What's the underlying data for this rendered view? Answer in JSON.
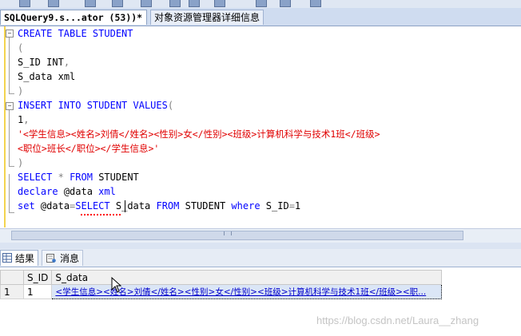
{
  "tabs": {
    "query_tab": "SQLQuery9.s...ator (53))*",
    "object_explorer_tab": "对象资源管理器详细信息"
  },
  "editor": {
    "lines": {
      "l1": {
        "kw1": "CREATE TABLE STUDENT"
      },
      "l2": {
        "p": "("
      },
      "l3": {
        "a": "S_ID",
        "b": "INT",
        "c": ","
      },
      "l4": {
        "a": "S_data",
        "b": "xml"
      },
      "l5": {
        "p": ")"
      },
      "l6": {
        "kw": "INSERT INTO STUDENT VALUES",
        "p": "("
      },
      "l7": {
        "a": "1",
        "c": ","
      },
      "l8": {
        "s": "'<学生信息><姓名>刘倩</姓名><性别>女</性别><班级>计算机科学与技术1班</班级>"
      },
      "l9": {
        "s": "<职位>班长</职位></学生信息>'"
      },
      "l10": {
        "p": ")"
      },
      "l11": {
        "kw1": "SELECT",
        "op": "*",
        "kw2": "FROM",
        "obj": "STUDENT"
      },
      "l12": {
        "kw": "declare",
        "var": "@data",
        "type": "xml"
      },
      "l13": {
        "kw1": "set",
        "var": "@data",
        "op": "=",
        "kw2": "SELECT",
        "col": "S_data",
        "kw3": "FROM",
        "obj": "STUDENT",
        "kw4": "where",
        "col2": "S_ID",
        "op2": "=",
        "num": "1"
      }
    }
  },
  "results": {
    "tab_results": "结果",
    "tab_messages": "消息",
    "columns": [
      "S_ID",
      "S_data"
    ],
    "rows": [
      {
        "rownum": "1",
        "S_ID": "1",
        "S_data": "<学生信息><姓名>刘倩</姓名><性别>女</性别><班级>计算机科学与技术1班</班级><职..."
      }
    ]
  },
  "watermark": "https://blog.csdn.net/Laura__zhang",
  "colors": {
    "keyword": "#0000ff",
    "string": "#e00000",
    "function": "#ff00ff",
    "punct": "#808080"
  }
}
